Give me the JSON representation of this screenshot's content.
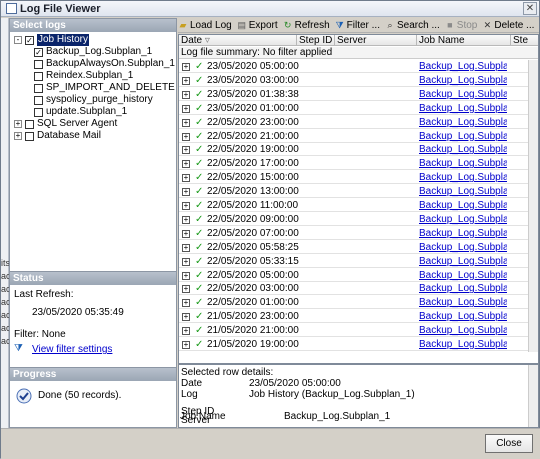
{
  "window": {
    "title": "Log File Viewer"
  },
  "left": {
    "select_logs_header": "Select logs",
    "tree": [
      {
        "label": "Job History",
        "checked": true,
        "expand": "-",
        "selected": true
      },
      {
        "label": "Backup_Log.Subplan_1",
        "checked": true
      },
      {
        "label": "BackupAlwaysOn.Subplan_1",
        "checked": false
      },
      {
        "label": "Reindex.Subplan_1",
        "checked": false
      },
      {
        "label": "SP_IMPORT_AND_DELETE",
        "checked": false
      },
      {
        "label": "syspolicy_purge_history",
        "checked": false
      },
      {
        "label": "update.Subplan_1",
        "checked": false
      },
      {
        "label": "SQL Server Agent",
        "checked": false,
        "expand": "+"
      },
      {
        "label": "Database Mail",
        "checked": false,
        "expand": "+"
      }
    ],
    "status_header": "Status",
    "last_refresh_label": "Last Refresh:",
    "last_refresh_value": "23/05/2020 05:35:49",
    "filter_label": "Filter: None",
    "view_filter_link": "View filter settings",
    "progress_header": "Progress",
    "progress_text": "Done (50 records)."
  },
  "left_strip": [
    "its",
    "ac",
    "ac",
    "ac",
    "ac",
    "ac",
    "ac"
  ],
  "toolbar": {
    "load_log": "Load Log",
    "export": "Export",
    "refresh": "Refresh",
    "filter": "Filter ...",
    "search": "Search ...",
    "stop": "Stop",
    "delete": "Delete ..."
  },
  "grid": {
    "columns": [
      "Date",
      "Step ID",
      "Server",
      "Job Name",
      "Ste"
    ],
    "summary": "Log file summary: No filter applied",
    "job_name": "Backup_Log.Subplan_1",
    "rows": [
      "23/05/2020 05:00:00",
      "23/05/2020 03:00:00",
      "23/05/2020 01:38:38",
      "23/05/2020 01:00:00",
      "22/05/2020 23:00:00",
      "22/05/2020 21:00:00",
      "22/05/2020 19:00:00",
      "22/05/2020 17:00:00",
      "22/05/2020 15:00:00",
      "22/05/2020 13:00:00",
      "22/05/2020 11:00:00",
      "22/05/2020 09:00:00",
      "22/05/2020 07:00:00",
      "22/05/2020 05:58:25",
      "22/05/2020 05:33:15",
      "22/05/2020 05:00:00",
      "22/05/2020 03:00:00",
      "22/05/2020 01:00:00",
      "21/05/2020 23:00:00",
      "21/05/2020 21:00:00",
      "21/05/2020 19:00:00"
    ]
  },
  "details": {
    "header": "Selected row details:",
    "date_label": "Date",
    "date_value": "23/05/2020 05:00:00",
    "log_label": "Log",
    "log_value": "Job History (Backup_Log.Subplan_1)",
    "step_label": "Step ID",
    "server_label": "Server",
    "job_label": "Job Name",
    "job_value": "Backup_Log.Subplan_1"
  },
  "bottom": {
    "close": "Close"
  }
}
